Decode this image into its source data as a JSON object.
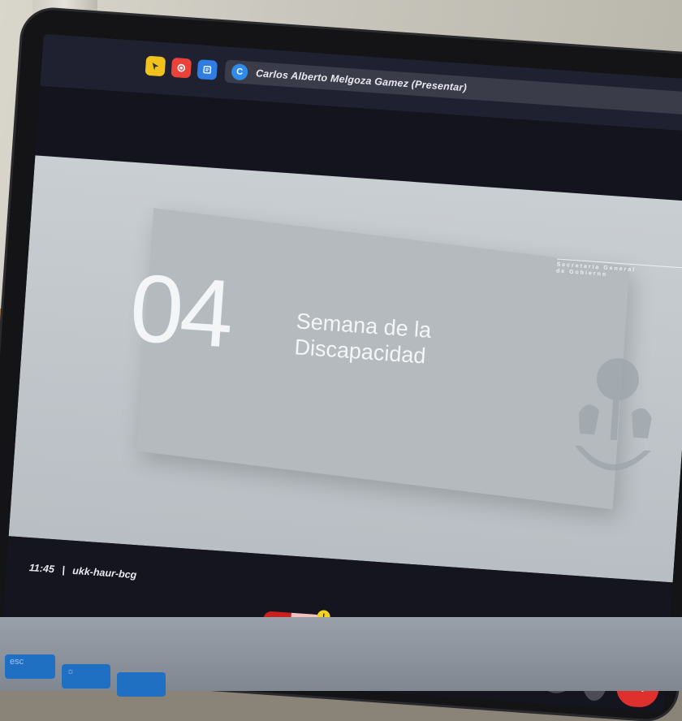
{
  "topbar": {
    "presenter_initial": "C",
    "presenter_name": "Carlos Alberto Melgoza Gamez (Presentar)"
  },
  "slide": {
    "number": "04",
    "title_line1": "Semana de la",
    "title_line2": "Discapacidad",
    "org_line1": "Secretaría General",
    "org_line2": "de Gobierno"
  },
  "meeting": {
    "time": "11:45",
    "separator": "|",
    "code": "ukk-haur-bcg"
  },
  "controls": {
    "mic_expand_label": "^",
    "cam_expand_label": "^",
    "mic_badge": "!",
    "cam_badge": "!"
  },
  "keyboard": {
    "esc_label": "esc",
    "f1_label": "☼"
  },
  "colors": {
    "accent_red": "#c8201f",
    "badge_yellow": "#f5d21e",
    "control_gray": "#4a4b55"
  }
}
